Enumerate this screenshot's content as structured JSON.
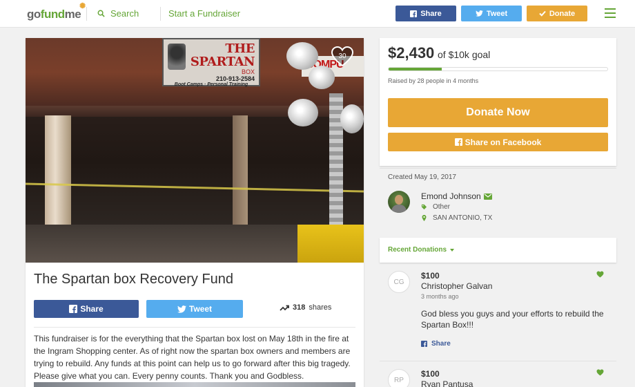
{
  "header": {
    "logo": {
      "go": "go",
      "fund": "fund",
      "me": "me"
    },
    "search_label": "Search",
    "start_label": "Start a Fundraiser",
    "share_label": "Share",
    "tweet_label": "Tweet",
    "donate_label": "Donate"
  },
  "campaign": {
    "photo": {
      "heart_count": "30",
      "sign_name": "THE SPARTAN",
      "sign_box": "BOX",
      "sign_phone": "210-913-2584",
      "sign_tagline": "Boot Camps · Personal Training",
      "red_sign": "COMPU"
    },
    "title": "The Spartan box Recovery Fund",
    "share_label": "Share",
    "tweet_label": "Tweet",
    "shares_count": "318",
    "shares_label": "shares",
    "story": "This fundraiser is for the everything that the Spartan box lost on May 18th in the fire at the Ingram Shopping center. As of right now the spartan box owners and members are trying to rebuild. Any funds at this point can help us to go forward after this big tragedy. Please give what you can. Every penny counts. Thank you and Godbless."
  },
  "donation": {
    "raised_amount": "$2,430",
    "goal_text": "of $10k goal",
    "progress_fraction": 0.243,
    "raised_by": "Raised by 28 people in 4 months",
    "donate_now_label": "Donate Now",
    "share_facebook_label": "Share on Facebook"
  },
  "organizer": {
    "created": "Created May 19, 2017",
    "name": "Emond Johnson",
    "category": "Other",
    "location": "SAN ANTONIO, TX"
  },
  "recent": {
    "label": "Recent Donations",
    "items": [
      {
        "initials": "CG",
        "amount": "$100",
        "name": "Christopher Galvan",
        "ago": "3 months ago",
        "message": "God bless you guys and your efforts to rebuild the Spartan Box!!!",
        "share_label": "Share"
      },
      {
        "initials": "RP",
        "amount": "$100",
        "name": "Ryan Pantusa"
      }
    ]
  },
  "colors": {
    "brand_green": "#65a637",
    "facebook_blue": "#3b5998",
    "twitter_blue": "#55acee",
    "donate_orange": "#e8a735"
  }
}
